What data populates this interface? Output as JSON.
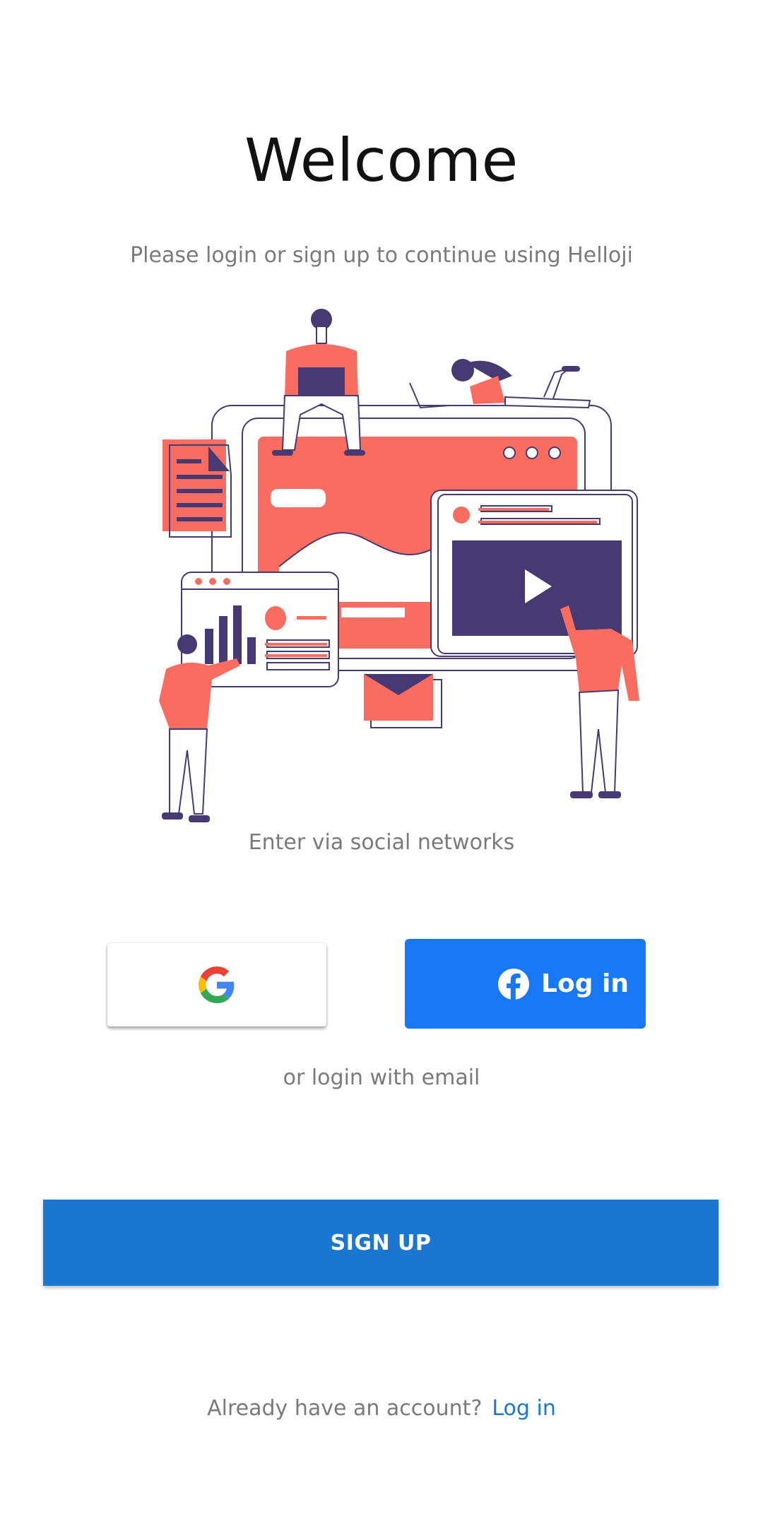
{
  "header": {
    "title": "Welcome",
    "subtitle": "Please login or sign up to continue using Helloji"
  },
  "social": {
    "caption": "Enter via social networks",
    "google_icon": "google-g-icon",
    "facebook_icon": "facebook-icon",
    "facebook_label": "Log in"
  },
  "email": {
    "caption": "or login with email"
  },
  "signup": {
    "label": "SIGN UP"
  },
  "footer": {
    "prompt": "Already have an account?",
    "login_label": "Log in"
  },
  "colors": {
    "primary_blue": "#1b76d2",
    "facebook_blue": "#1877f2",
    "illustration_coral": "#f96c60",
    "illustration_navy": "#473a74"
  }
}
